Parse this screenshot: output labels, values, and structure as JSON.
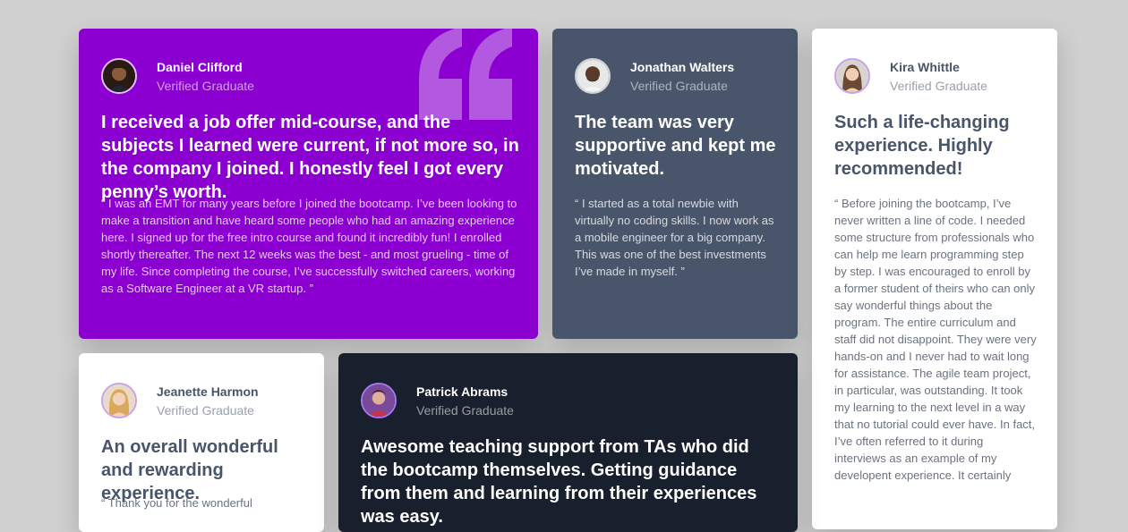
{
  "palette": {
    "background": "#d0d0d0",
    "purple": "#8b00d0",
    "slate": "#48556a",
    "white": "#ffffff",
    "dark": "#19202d"
  },
  "testimonials": [
    {
      "name": "Daniel Clifford",
      "role": "Verified Graduate",
      "headline": "I received a job offer mid-course, and the subjects I learned were current, if not more so, in the company I joined. I honestly feel I got every penny’s worth.",
      "quote": "“ I was an EMT for many years before I joined the bootcamp. I’ve been looking to make a transition and have heard some people who had an amazing experience here. I signed up for the free intro course and found it incredibly fun! I enrolled shortly thereafter. The next 12 weeks was the best - and most grueling - time of my life. Since completing the course, I’ve successfully switched careers, working as a Software Engineer at a VR startup. ”"
    },
    {
      "name": "Jonathan Walters",
      "role": "Verified Graduate",
      "headline": "The team was very supportive and kept me motivated.",
      "quote": "“ I started as a total newbie with virtually no coding skills. I now work as a mobile engineer for a big company. This was one of the best investments I’ve made in myself. ”"
    },
    {
      "name": "Kira Whittle",
      "role": "Verified Graduate",
      "headline": "Such a life-changing experience. Highly recommended!",
      "quote": "“ Before joining the bootcamp, I’ve never written a line of code. I needed some structure from professionals who can help me learn programming step by step. I was encouraged to enroll by a former student of theirs who can only say wonderful things about the program. The entire curriculum and staff did not disappoint. They were very hands-on and I never had to wait long for assistance. The agile team project, in particular, was outstanding. It took my learning to the next level in a way that no tutorial could ever have. In fact, I’ve often referred to it during interviews as an example of my developent experience. It certainly"
    },
    {
      "name": "Jeanette Harmon",
      "role": "Verified Graduate",
      "headline": "An overall wonderful and rewarding experience.",
      "quote": "“ Thank you for the wonderful"
    },
    {
      "name": "Patrick Abrams",
      "role": "Verified Graduate",
      "headline": "Awesome teaching support from TAs who did the bootcamp themselves. Getting guidance from them and learning from their experiences was easy.",
      "quote": ""
    }
  ]
}
